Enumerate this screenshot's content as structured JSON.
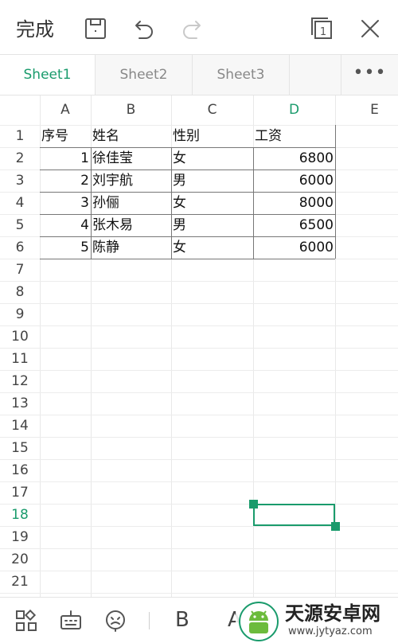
{
  "toolbar": {
    "done_label": "完成",
    "icons": [
      "save-icon",
      "undo-icon",
      "redo-icon",
      "window-count-icon",
      "close-icon"
    ],
    "window_count": "1"
  },
  "sheet_tabs": [
    {
      "label": "Sheet1",
      "active": true
    },
    {
      "label": "Sheet2",
      "active": false
    },
    {
      "label": "Sheet3",
      "active": false
    }
  ],
  "sheet_more_label": "•••",
  "colors": {
    "accent": "#1a9b6c",
    "grid_line": "#e8e8e8",
    "data_border": "#777777"
  },
  "spreadsheet": {
    "columns": [
      "A",
      "B",
      "C",
      "D",
      "E"
    ],
    "active_column": "D",
    "rows": [
      "1",
      "2",
      "3",
      "4",
      "5",
      "6",
      "7",
      "8",
      "9",
      "10",
      "11",
      "12",
      "13",
      "14",
      "15",
      "16",
      "17",
      "18",
      "19",
      "20",
      "21"
    ],
    "active_row": "18",
    "cells": [
      [
        {
          "value": "序号",
          "align": "left"
        },
        {
          "value": "姓名",
          "align": "left"
        },
        {
          "value": "性别",
          "align": "left"
        },
        {
          "value": "工资",
          "align": "left"
        }
      ],
      [
        {
          "value": "1",
          "align": "right"
        },
        {
          "value": "徐佳莹",
          "align": "left"
        },
        {
          "value": "女",
          "align": "left"
        },
        {
          "value": "6800",
          "align": "right"
        }
      ],
      [
        {
          "value": "2",
          "align": "right"
        },
        {
          "value": "刘宇航",
          "align": "left"
        },
        {
          "value": "男",
          "align": "left"
        },
        {
          "value": "6000",
          "align": "right"
        }
      ],
      [
        {
          "value": "3",
          "align": "right"
        },
        {
          "value": "孙俪",
          "align": "left"
        },
        {
          "value": "女",
          "align": "left"
        },
        {
          "value": "8000",
          "align": "right"
        }
      ],
      [
        {
          "value": "4",
          "align": "right"
        },
        {
          "value": "张木易",
          "align": "left"
        },
        {
          "value": "男",
          "align": "left"
        },
        {
          "value": "6500",
          "align": "right"
        }
      ],
      [
        {
          "value": "5",
          "align": "right"
        },
        {
          "value": "陈静",
          "align": "left"
        },
        {
          "value": "女",
          "align": "left"
        },
        {
          "value": "6000",
          "align": "right"
        }
      ]
    ],
    "selected_cell": "D18"
  },
  "bottom_toolbar": {
    "icons": [
      "apps-grid-icon",
      "keyboard-icon",
      "emoji-icon"
    ],
    "bold_label": "B",
    "font_color_label": "A"
  },
  "watermark": {
    "title": "天源安卓网",
    "url": "www.jytyaz.com",
    "logo_icon": "android-robot-icon"
  }
}
